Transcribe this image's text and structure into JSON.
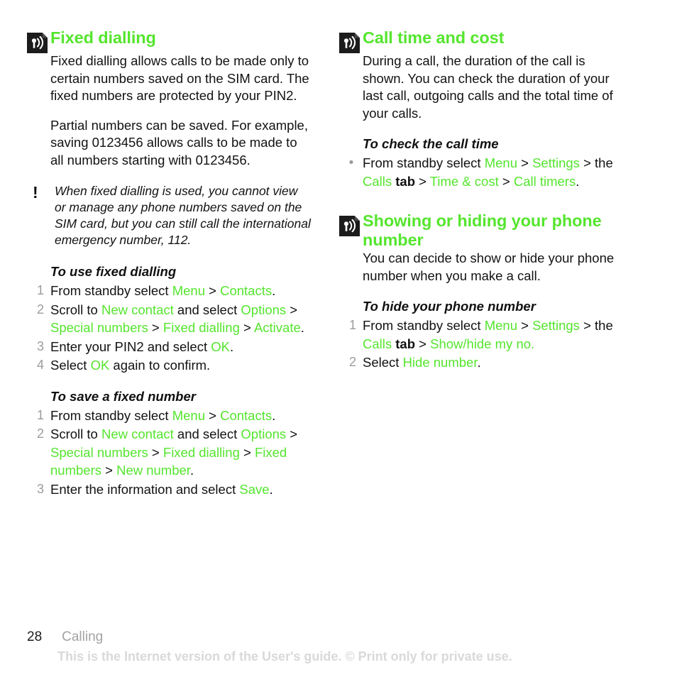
{
  "document": {
    "icon_name": "signal-wave-icon",
    "note_icon_glyph": "!",
    "bullet_glyph": "•",
    "accent_color": "#55e52e",
    "gt": " > "
  },
  "left_column": {
    "section": {
      "title": "Fixed dialling",
      "paragraphs": [
        "Fixed dialling allows calls to be made only to certain numbers saved on the SIM card. The fixed numbers are protected by your PIN2.",
        "Partial numbers can be saved. For example, saving 0123456 allows calls to be made to all numbers starting with 0123456."
      ],
      "note": "When fixed dialling is used, you cannot view or manage any phone numbers saved on the SIM card, but you can still call the international emergency number, 112."
    },
    "procedure_1": {
      "title": "To use fixed dialling",
      "steps": [
        {
          "num": "1",
          "parts": [
            {
              "t": "From standby select ",
              "k": "plain"
            },
            {
              "t": "Menu",
              "k": "ui"
            },
            {
              "t": " > ",
              "k": "plain"
            },
            {
              "t": "Contacts",
              "k": "ui"
            },
            {
              "t": ".",
              "k": "plain"
            }
          ]
        },
        {
          "num": "2",
          "parts": [
            {
              "t": "Scroll to ",
              "k": "plain"
            },
            {
              "t": "New contact",
              "k": "ui"
            },
            {
              "t": " and select ",
              "k": "plain"
            },
            {
              "t": "Options",
              "k": "ui"
            },
            {
              "t": " > ",
              "k": "plain"
            },
            {
              "t": "Special numbers",
              "k": "ui"
            },
            {
              "t": " > ",
              "k": "plain"
            },
            {
              "t": "Fixed dialling",
              "k": "ui"
            },
            {
              "t": " > ",
              "k": "plain"
            },
            {
              "t": "Activate",
              "k": "ui"
            },
            {
              "t": ".",
              "k": "plain"
            }
          ]
        },
        {
          "num": "3",
          "parts": [
            {
              "t": "Enter your PIN2 and select ",
              "k": "plain"
            },
            {
              "t": "OK",
              "k": "ui"
            },
            {
              "t": ".",
              "k": "plain"
            }
          ]
        },
        {
          "num": "4",
          "parts": [
            {
              "t": "Select ",
              "k": "plain"
            },
            {
              "t": "OK",
              "k": "ui"
            },
            {
              "t": " again to confirm.",
              "k": "plain"
            }
          ]
        }
      ]
    },
    "procedure_2": {
      "title": "To save a fixed number",
      "steps": [
        {
          "num": "1",
          "parts": [
            {
              "t": "From standby select ",
              "k": "plain"
            },
            {
              "t": "Menu",
              "k": "ui"
            },
            {
              "t": " > ",
              "k": "plain"
            },
            {
              "t": "Contacts",
              "k": "ui"
            },
            {
              "t": ".",
              "k": "plain"
            }
          ]
        },
        {
          "num": "2",
          "parts": [
            {
              "t": "Scroll to ",
              "k": "plain"
            },
            {
              "t": "New contact",
              "k": "ui"
            },
            {
              "t": " and select ",
              "k": "plain"
            },
            {
              "t": "Options",
              "k": "ui"
            },
            {
              "t": " > ",
              "k": "plain"
            },
            {
              "t": "Special numbers",
              "k": "ui"
            },
            {
              "t": " > ",
              "k": "plain"
            },
            {
              "t": "Fixed dialling",
              "k": "ui"
            },
            {
              "t": " > ",
              "k": "plain"
            },
            {
              "t": "Fixed numbers",
              "k": "ui"
            },
            {
              "t": " > ",
              "k": "plain"
            },
            {
              "t": "New number",
              "k": "ui"
            },
            {
              "t": ".",
              "k": "plain"
            }
          ]
        },
        {
          "num": "3",
          "parts": [
            {
              "t": "Enter the information and select ",
              "k": "plain"
            },
            {
              "t": "Save",
              "k": "ui"
            },
            {
              "t": ".",
              "k": "plain"
            }
          ]
        }
      ]
    }
  },
  "right_column": {
    "section_1": {
      "title": "Call time and cost",
      "paragraphs": [
        "During a call, the duration of the call is shown. You can check the duration of your last call, outgoing calls and the total time of your calls."
      ]
    },
    "procedure_1": {
      "title": "To check the call time",
      "steps": [
        {
          "bullet": "•",
          "parts": [
            {
              "t": "From standby select ",
              "k": "plain"
            },
            {
              "t": "Menu",
              "k": "ui"
            },
            {
              "t": " > ",
              "k": "plain"
            },
            {
              "t": "Settings",
              "k": "ui"
            },
            {
              "t": " > the ",
              "k": "plain"
            },
            {
              "t": "Calls",
              "k": "ui"
            },
            {
              "t": " tab",
              "k": "bold"
            },
            {
              "t": " > ",
              "k": "plain"
            },
            {
              "t": "Time & cost",
              "k": "ui"
            },
            {
              "t": " > ",
              "k": "plain"
            },
            {
              "t": "Call timers",
              "k": "ui"
            },
            {
              "t": ".",
              "k": "plain"
            }
          ]
        }
      ]
    },
    "section_2": {
      "title": "Showing or hiding your phone number",
      "paragraphs": [
        "You can decide to show or hide your phone number when you make a call."
      ]
    },
    "procedure_2": {
      "title": "To hide your phone number",
      "steps": [
        {
          "num": "1",
          "parts": [
            {
              "t": "From standby select ",
              "k": "plain"
            },
            {
              "t": "Menu",
              "k": "ui"
            },
            {
              "t": " > ",
              "k": "plain"
            },
            {
              "t": "Settings",
              "k": "ui"
            },
            {
              "t": " > the ",
              "k": "plain"
            },
            {
              "t": "Calls",
              "k": "ui"
            },
            {
              "t": " tab",
              "k": "bold"
            },
            {
              "t": " > ",
              "k": "plain"
            },
            {
              "t": "Show/hide my no.",
              "k": "ui"
            }
          ]
        },
        {
          "num": "2",
          "parts": [
            {
              "t": "Select ",
              "k": "plain"
            },
            {
              "t": "Hide number",
              "k": "ui"
            },
            {
              "t": ".",
              "k": "plain"
            }
          ]
        }
      ]
    }
  },
  "footer": {
    "page_number": "28",
    "chapter": "Calling",
    "disclaimer": "This is the Internet version of the User's guide. © Print only for private use."
  }
}
